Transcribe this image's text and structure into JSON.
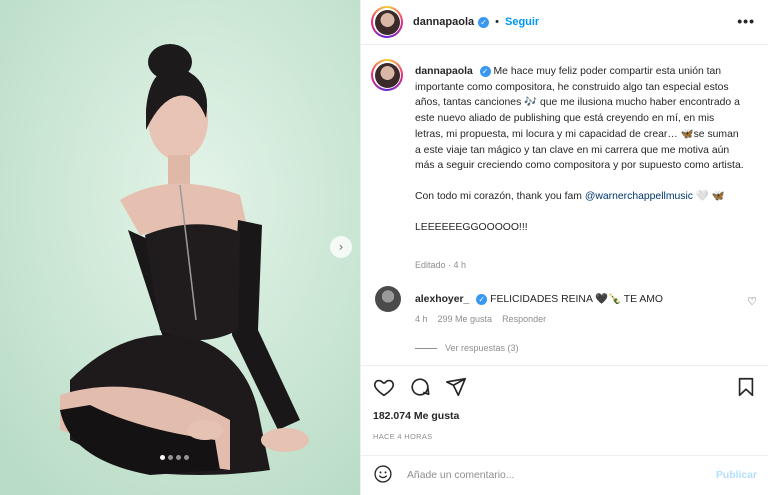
{
  "header": {
    "username": "dannapaola",
    "verified_badge": "✓",
    "separator": "•",
    "follow_label": "Seguir",
    "more_label": "•••"
  },
  "media": {
    "next_label": "›",
    "carousel_dots": 4,
    "active_dot": 0
  },
  "caption": {
    "username": "dannapaola",
    "paragraph1": "Me hace muy feliz poder compartir esta unión tan importante como compositora, he construido algo tan especial estos años, tantas canciones 🎶 que me ilusiona mucho haber encontrado a este nuevo aliado de publishing que está creyendo en mí, en mis letras, mi propuesta, mi locura y mi capacidad de crear… 🦋se suman a este viaje tan mágico y tan clave en mi carrera que me motiva aún más a seguir creciendo como compositora y por supuesto como artista.",
    "paragraph2_prefix": "Con todo mi corazón, thank you fam ",
    "mention": "@warnerchappellmusic",
    "paragraph2_suffix": " 🤍 🦋",
    "paragraph3": "LEEEEEEGGOOOOO!!!",
    "meta": "Editado · 4 h"
  },
  "comment": {
    "username": "alexhoyer_",
    "text": "FELICIDADES REINA 🖤🍾 TE AMO",
    "time": "4 h",
    "likes": "299 Me gusta",
    "reply": "Responder",
    "heart": "♡",
    "view_replies": "Ver respuestas (3)"
  },
  "actions": {
    "likes_count": "182.074 Me gusta",
    "posted": "HACE 4 HORAS"
  },
  "add_comment": {
    "placeholder": "Añade un comentario...",
    "publish": "Publicar"
  },
  "colors": {
    "accent": "#0095f6",
    "verified": "#3897f0",
    "muted": "#8e8e8e",
    "background_photo": "#cfe9d9",
    "publish_disabled": "#b2dffc"
  }
}
